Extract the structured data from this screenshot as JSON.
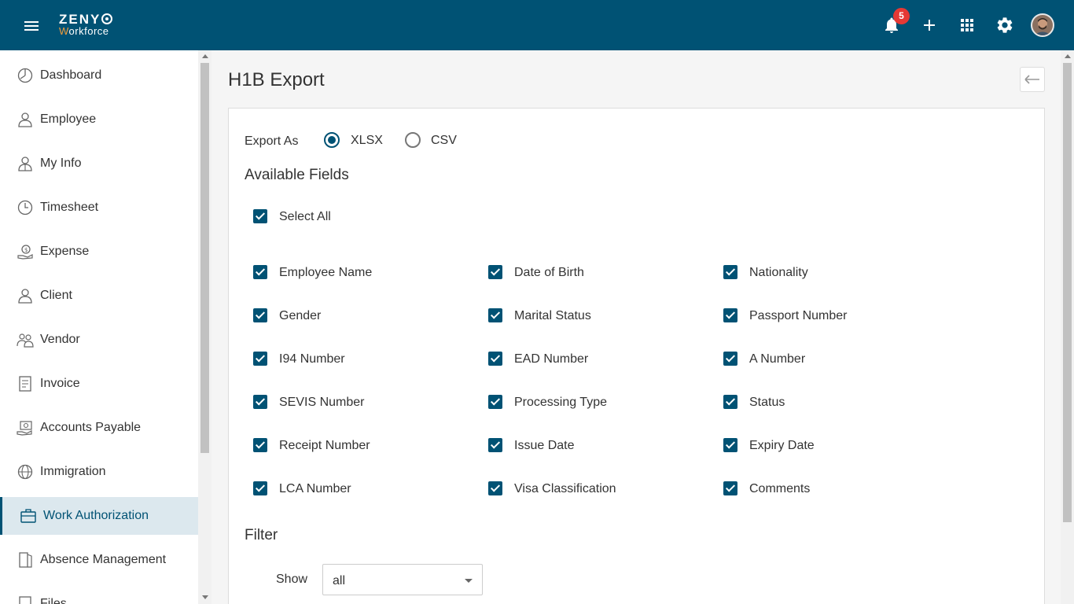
{
  "app": {
    "logo_top": "ZENY",
    "logo_bottom_first": "W",
    "logo_bottom_rest": "orkforce",
    "notification_count": "5"
  },
  "sidebar": {
    "items": [
      {
        "label": "Dashboard",
        "icon": "dashboard-icon"
      },
      {
        "label": "Employee",
        "icon": "employee-icon"
      },
      {
        "label": "My Info",
        "icon": "my-info-icon"
      },
      {
        "label": "Timesheet",
        "icon": "clock-icon"
      },
      {
        "label": "Expense",
        "icon": "expense-icon"
      },
      {
        "label": "Client",
        "icon": "client-icon"
      },
      {
        "label": "Vendor",
        "icon": "vendor-icon"
      },
      {
        "label": "Invoice",
        "icon": "invoice-icon"
      },
      {
        "label": "Accounts Payable",
        "icon": "accounts-payable-icon"
      },
      {
        "label": "Immigration",
        "icon": "globe-icon"
      },
      {
        "label": "Work Authorization",
        "icon": "briefcase-icon",
        "active": true
      },
      {
        "label": "Absence Management",
        "icon": "door-icon"
      },
      {
        "label": "Files",
        "icon": "files-icon"
      }
    ]
  },
  "main": {
    "title": "H1B Export",
    "export_as_label": "Export As",
    "formats": [
      {
        "label": "XLSX",
        "selected": true
      },
      {
        "label": "CSV",
        "selected": false
      }
    ],
    "available_fields_title": "Available Fields",
    "select_all_label": "Select All",
    "fields": [
      [
        "Employee Name",
        "Date of Birth",
        "Nationality"
      ],
      [
        "Gender",
        "Marital Status",
        "Passport Number"
      ],
      [
        "I94 Number",
        "EAD Number",
        "A Number"
      ],
      [
        "SEVIS Number",
        "Processing Type",
        "Status"
      ],
      [
        "Receipt Number",
        "Issue Date",
        "Expiry Date"
      ],
      [
        "LCA Number",
        "Visa Classification",
        "Comments"
      ]
    ],
    "filter_title": "Filter",
    "show_label": "Show",
    "show_value": "all"
  },
  "colors": {
    "primary": "#005274",
    "accent": "#f39c3a",
    "badge": "#e53935",
    "active_bg": "#dce8ee"
  }
}
